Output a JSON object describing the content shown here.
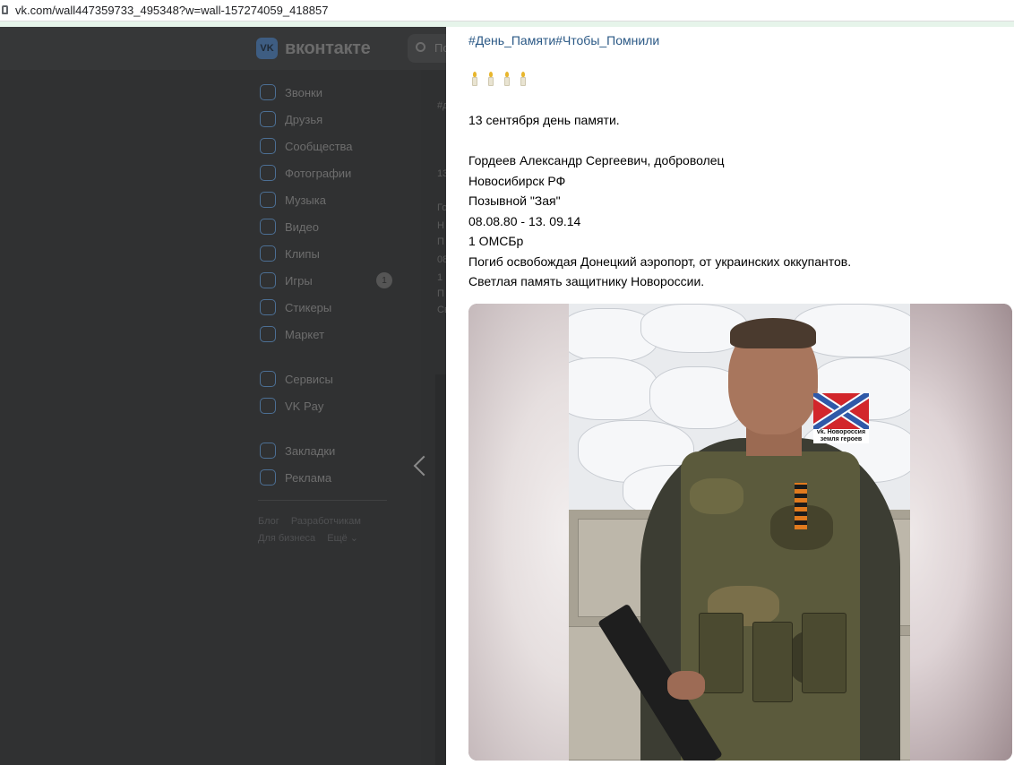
{
  "browser": {
    "url": "vk.com/wall447359733_495348?w=wall-157274059_418857"
  },
  "vk": {
    "logo_mark": "VK",
    "logo_text": "вконтакте",
    "search_placeholder": "По",
    "nav": [
      {
        "label": "Звонки",
        "icon": "phone-icon"
      },
      {
        "label": "Друзья",
        "icon": "friends-icon"
      },
      {
        "label": "Сообщества",
        "icon": "communities-icon"
      },
      {
        "label": "Фотографии",
        "icon": "photos-icon"
      },
      {
        "label": "Музыка",
        "icon": "music-icon"
      },
      {
        "label": "Видео",
        "icon": "video-icon"
      },
      {
        "label": "Клипы",
        "icon": "clips-icon"
      },
      {
        "label": "Игры",
        "icon": "games-icon",
        "badge": "1"
      },
      {
        "label": "Стикеры",
        "icon": "stickers-icon"
      },
      {
        "label": "Маркет",
        "icon": "market-icon"
      }
    ],
    "nav_extra": [
      {
        "label": "Сервисы",
        "icon": "services-icon"
      },
      {
        "label": "VK Pay",
        "icon": "vkpay-icon"
      }
    ],
    "nav_extra2": [
      {
        "label": "Закладки",
        "icon": "bookmarks-icon"
      },
      {
        "label": "Реклама",
        "icon": "ads-icon"
      }
    ],
    "footer": {
      "blog": "Блог",
      "developers": "Разработчикам",
      "business": "Для бизнеса",
      "more": "Ещё ⌄"
    },
    "feed_fragments": [
      "#д",
      "13",
      "Го",
      "Н",
      "П",
      "08",
      "1",
      "П",
      "Св"
    ]
  },
  "post": {
    "hashtags": "#День_Памяти#Чтобы_Помнили",
    "candles_count": 4,
    "line_memorial_day": "13 сентября день памяти.",
    "lines": [
      "Гордеев Александр Сергеевич, доброволец",
      "Новосибирск РФ",
      "Позывной \"Зая\"",
      "08.08.80 - 13. 09.14",
      "1 ОМСБр",
      "Погиб освобождая Донецкий аэропорт, от украинских оккупантов.",
      "Светлая память защитнику Новороссии."
    ],
    "photo": {
      "flag_caption_line1": "vk. Новороссия",
      "flag_caption_line2": "земля героев"
    }
  },
  "colors": {
    "link": "#2a5885",
    "vk_accent": "#3e5d82",
    "flag_red": "#d2262b",
    "flag_blue": "#2f59a8"
  }
}
